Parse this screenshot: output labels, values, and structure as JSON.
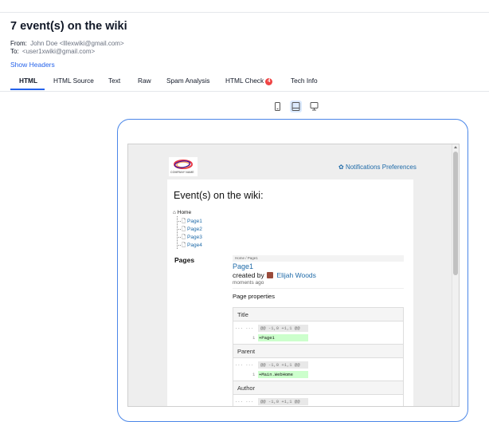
{
  "header": {
    "title": "7 event(s) on the wiki",
    "from_label": "From:",
    "from_value": "John Doe <lllexwiki@gmail.com>",
    "to_label": "To:",
    "to_value": "<user1xwiki@gmail.com>",
    "show_headers": "Show Headers"
  },
  "tabs": [
    {
      "label": "HTML",
      "active": true
    },
    {
      "label": "HTML Source"
    },
    {
      "label": "Text"
    },
    {
      "label": "Raw"
    },
    {
      "label": "Spam Analysis"
    },
    {
      "label": "HTML Check",
      "badge": "4"
    },
    {
      "label": "Tech Info"
    }
  ],
  "device_toggle": {
    "options": [
      "mobile-icon",
      "tablet-icon",
      "desktop-icon"
    ],
    "selected": "tablet-icon"
  },
  "email": {
    "logo_text": "COMPANY NAME",
    "notifications_link": "Notifications Preferences",
    "heading": "Event(s) on the wiki:",
    "tree": {
      "root": "Home",
      "children": [
        "Page1",
        "Page2",
        "Page3",
        "Page4"
      ]
    },
    "section_label": "Pages",
    "breadcrumb": "Home / Page1",
    "page_title": "Page1",
    "created_by_label": "created by",
    "author": "Elijah Woods",
    "time_ago": "moments ago",
    "properties_title": "Page properties",
    "properties": [
      {
        "name": "Title",
        "dots": "··· ···",
        "hunk": "@@ -1,0 +1,1 @@",
        "line": "1",
        "added": "+Page1"
      },
      {
        "name": "Parent",
        "dots": "··· ···",
        "hunk": "@@ -1,0 +1,1 @@",
        "line": "1",
        "added": "+Main.WebHome"
      },
      {
        "name": "Author",
        "dots": "··· ···",
        "hunk": "@@ -1,0 +1,1 @@",
        "line": "",
        "added": ""
      }
    ]
  },
  "colors": {
    "accent": "#2563eb",
    "badge": "#ef4444",
    "link": "#1e6aa8",
    "frame": "#4a86e8",
    "diff_added": "#ccffcc"
  }
}
